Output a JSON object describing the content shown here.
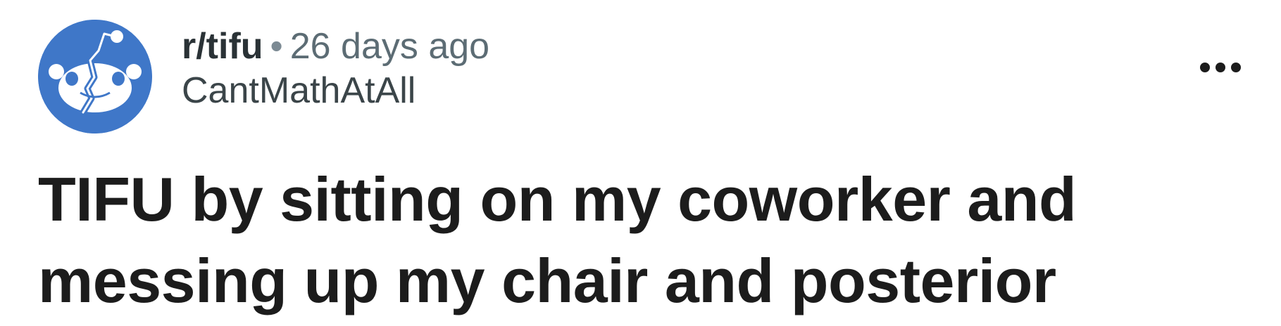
{
  "post": {
    "subreddit": "r/tifu",
    "separator": "•",
    "time_ago": "26 days ago",
    "author": "CantMathAtAll",
    "title": "TIFU by sitting on my coworker and messing up my chair and posterior"
  },
  "icons": {
    "avatar": "tifu-subreddit-icon",
    "more": "more-options-icon"
  },
  "colors": {
    "avatar_background": "#3f77c8",
    "title_text": "#1c1c1c",
    "meta_text": "#5c6c74"
  }
}
